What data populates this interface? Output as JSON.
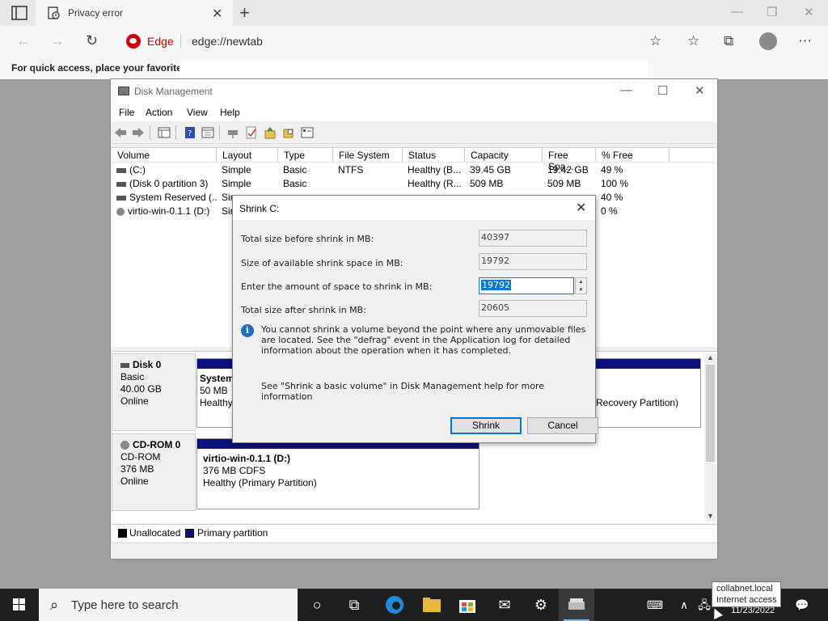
{
  "browser": {
    "tab_title": "Privacy error",
    "new_tab_symbol": "+",
    "brand": "Edge",
    "url": "edge://newtab",
    "favorites_hint": "For quick access, place your favorites h"
  },
  "disk_management": {
    "title": "Disk Management",
    "menu": [
      "File",
      "Action",
      "View",
      "Help"
    ],
    "columns": [
      "Volume",
      "Layout",
      "Type",
      "File System",
      "Status",
      "Capacity",
      "Free Spa...",
      "% Free"
    ],
    "volumes": [
      {
        "volume": "(C:)",
        "layout": "Simple",
        "type": "Basic",
        "fs": "NTFS",
        "status": "Healthy (B...",
        "capacity": "39.45 GB",
        "free": "19.42 GB",
        "pct": "49 %"
      },
      {
        "volume": "(Disk 0 partition 3)",
        "layout": "Simple",
        "type": "Basic",
        "fs": "",
        "status": "Healthy (R...",
        "capacity": "509 MB",
        "free": "509 MB",
        "pct": "100 %"
      },
      {
        "volume": "System Reserved (...",
        "layout": "Sim",
        "type": "",
        "fs": "",
        "status": "",
        "capacity": "",
        "free": "",
        "pct": "40 %"
      },
      {
        "volume": "virtio-win-0.1.1 (D:)",
        "layout": "Sir",
        "type": "",
        "fs": "",
        "status": "",
        "capacity": "",
        "free": "",
        "pct": "0 %"
      }
    ],
    "disks": [
      {
        "name": "Disk 0",
        "type": "Basic",
        "size": "40.00 GB",
        "state": "Online",
        "partitions": [
          {
            "title": "System",
            "line2": "50 MB",
            "line3": "Healthy"
          },
          {
            "title": "",
            "line2": "",
            "line3": "Recovery Partition)"
          }
        ]
      },
      {
        "name": "CD-ROM 0",
        "type": "CD-ROM",
        "size": "376 MB",
        "state": "Online",
        "partitions": [
          {
            "title": "virtio-win-0.1.1  (D:)",
            "line2": "376 MB CDFS",
            "line3": "Healthy (Primary Partition)"
          }
        ]
      }
    ],
    "legend": [
      {
        "label": "Unallocated",
        "color": "#000000"
      },
      {
        "label": "Primary partition",
        "color": "#0a1178"
      }
    ]
  },
  "shrink_dialog": {
    "title": "Shrink C:",
    "total_before_label": "Total size before shrink in MB:",
    "total_before_value": "40397",
    "available_label": "Size of available shrink space in MB:",
    "available_value": "19792",
    "amount_label": "Enter the amount of space to shrink in MB:",
    "amount_value": "19792",
    "total_after_label": "Total size after shrink in MB:",
    "total_after_value": "20605",
    "info_text": "You cannot shrink a volume beyond the point where any unmovable files are located. See the \"defrag\" event in the Application log for detailed information about the operation when it has completed.",
    "help_text": "See \"Shrink a basic volume\" in Disk Management help for more information",
    "shrink_button": "Shrink",
    "cancel_button": "Cancel"
  },
  "taskbar": {
    "search_placeholder": "Type here to search",
    "tooltip_line1": "collabnet.local",
    "tooltip_line2": "Internet access",
    "date": "11/23/2022"
  }
}
